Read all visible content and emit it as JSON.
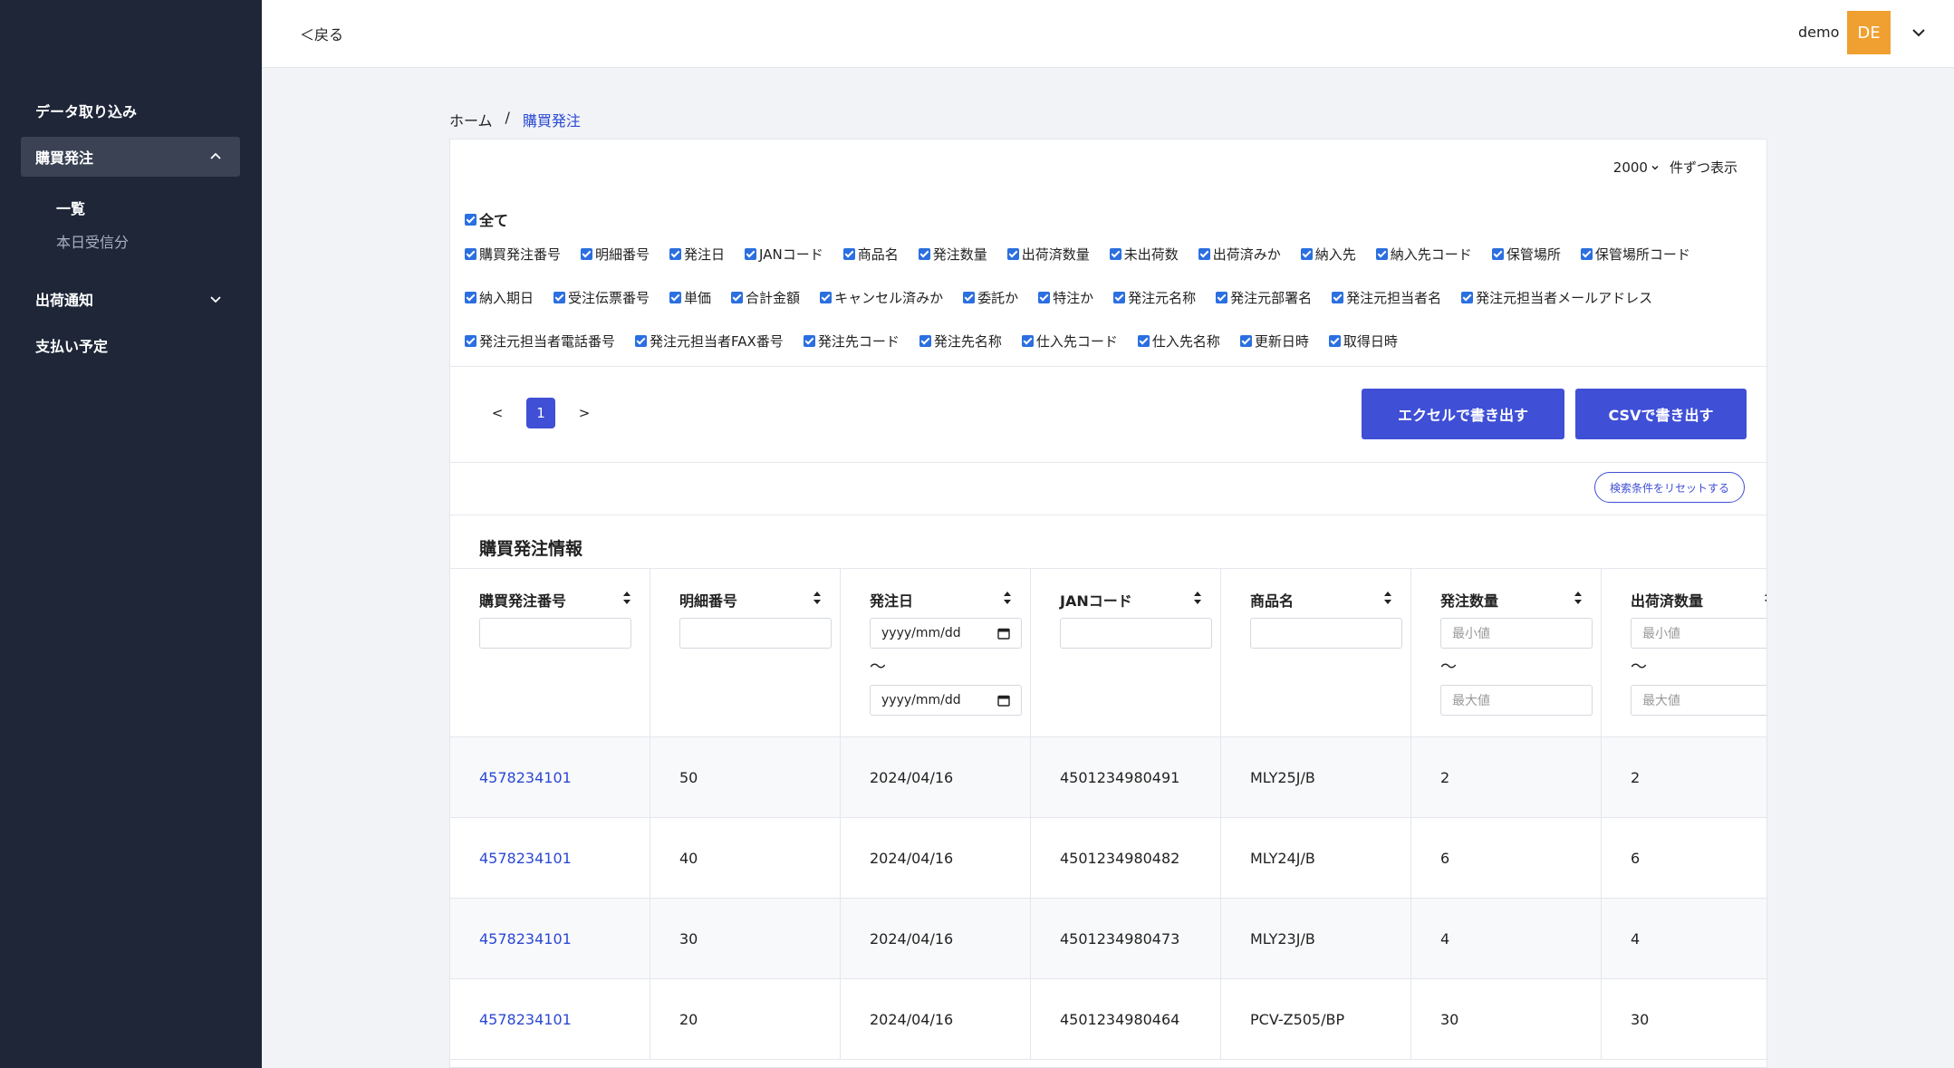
{
  "header": {
    "back_label": "＜戻る",
    "user_name": "demo",
    "avatar_initials": "DE"
  },
  "sidebar": {
    "items": [
      {
        "label": "データ取り込み"
      },
      {
        "label": "購買発注"
      },
      {
        "label": "出荷通知"
      },
      {
        "label": "支払い予定"
      }
    ],
    "sub_items": [
      {
        "label": "一覧"
      },
      {
        "label": "本日受信分"
      }
    ]
  },
  "breadcrumb": {
    "home": "ホーム",
    "separator": "/",
    "current": "購買発注"
  },
  "per_page": {
    "value": "2000",
    "suffix": "件ずつ表示"
  },
  "columns_filter": {
    "all_label": "全て",
    "row1": [
      "購買発注番号",
      "明細番号",
      "発注日",
      "JANコード",
      "商品名",
      "発注数量",
      "出荷済数量",
      "未出荷数",
      "出荷済みか",
      "納入先",
      "納入先コード",
      "保管場所",
      "保管場所コード"
    ],
    "row2": [
      "納入期日",
      "受注伝票番号",
      "単価",
      "合計金額",
      "キャンセル済みか",
      "委託か",
      "特注か",
      "発注元名称",
      "発注元部署名",
      "発注元担当者名",
      "発注元担当者メールアドレス"
    ],
    "row3": [
      "発注元担当者電話番号",
      "発注元担当者FAX番号",
      "発注先コード",
      "発注先名称",
      "仕入先コード",
      "仕入先名称",
      "更新日時",
      "取得日時"
    ]
  },
  "pagination": {
    "prev": "<",
    "current": "1",
    "next": ">"
  },
  "actions": {
    "excel_export": "エクセルで書き出す",
    "csv_export": "CSVで書き出す",
    "reset_filters": "検索条件をリセットする"
  },
  "section_title": "購買発注情報",
  "table": {
    "headers": [
      "購買発注番号",
      "明細番号",
      "発注日",
      "JANコード",
      "商品名",
      "発注数量",
      "出荷済数量"
    ],
    "date_placeholder": "yyyy/mm/dd",
    "min_placeholder": "最小値",
    "max_placeholder": "最大値",
    "range_separator": "〜",
    "rows": [
      [
        "4578234101",
        "50",
        "2024/04/16",
        "4501234980491",
        "MLY25J/B",
        "2",
        "2"
      ],
      [
        "4578234101",
        "40",
        "2024/04/16",
        "4501234980482",
        "MLY24J/B",
        "6",
        "6"
      ],
      [
        "4578234101",
        "30",
        "2024/04/16",
        "4501234980473",
        "MLY23J/B",
        "4",
        "4"
      ],
      [
        "4578234101",
        "20",
        "2024/04/16",
        "4501234980464",
        "PCV-Z505/BP",
        "30",
        "30"
      ]
    ]
  },
  "colors": {
    "sidebar_bg": "#1e2638",
    "accent": "#3f4fd6",
    "link": "#2b48d4",
    "avatar_bg": "#f0a030"
  }
}
